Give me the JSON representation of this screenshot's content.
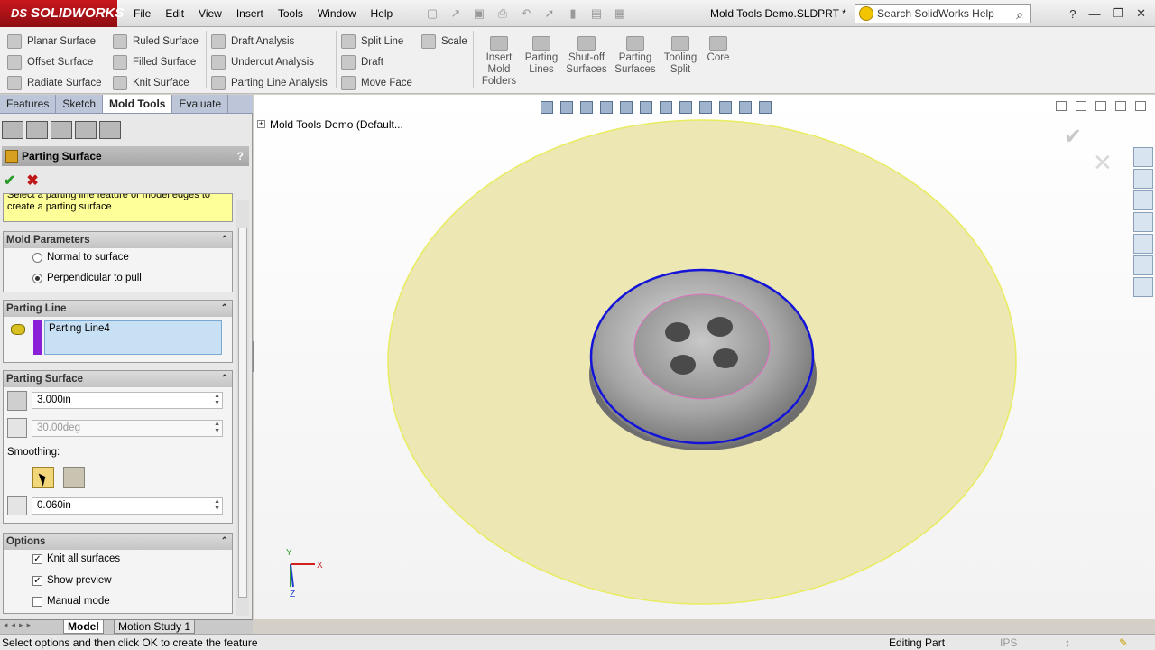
{
  "app": {
    "brand": "SOLIDWORKS",
    "brand_prefix": "DS",
    "document_title": "Mold Tools Demo.SLDPRT *",
    "help_search_placeholder": "Search SolidWorks Help"
  },
  "menu": [
    "File",
    "Edit",
    "View",
    "Insert",
    "Tools",
    "Window",
    "Help"
  ],
  "ribbon": {
    "col1": [
      "Planar Surface",
      "Offset Surface",
      "Radiate Surface"
    ],
    "col2": [
      "Ruled Surface",
      "Filled Surface",
      "Knit Surface"
    ],
    "col3": [
      "Draft Analysis",
      "Undercut Analysis",
      "Parting Line Analysis"
    ],
    "col4": [
      "Split Line",
      "Draft",
      "Move Face"
    ],
    "col5": [
      "Scale"
    ],
    "big": [
      {
        "label_lines": [
          "Insert",
          "Mold",
          "Folders"
        ]
      },
      {
        "label_lines": [
          "Parting",
          "Lines"
        ]
      },
      {
        "label_lines": [
          "Shut-off",
          "Surfaces"
        ]
      },
      {
        "label_lines": [
          "Parting",
          "Surfaces"
        ]
      },
      {
        "label_lines": [
          "Tooling",
          "Split"
        ]
      },
      {
        "label_lines": [
          "Core"
        ]
      }
    ]
  },
  "tabs": [
    "Features",
    "Sketch",
    "Mold Tools",
    "Evaluate"
  ],
  "active_tab": "Mold Tools",
  "property_manager": {
    "title": "Parting Surface",
    "help": "?",
    "message_line1": "Select a parting line feature or model edges to",
    "message_line2": "create a parting surface",
    "groups": {
      "mold_parameters": {
        "title": "Mold Parameters",
        "options": [
          "Normal to surface",
          "Perpendicular to pull"
        ],
        "selected": "Perpendicular to pull"
      },
      "parting_line": {
        "title": "Parting Line",
        "selection": "Parting Line4"
      },
      "parting_surface": {
        "title": "Parting Surface",
        "distance": "3.000in",
        "angle": "30.00deg",
        "smoothing_label": "Smoothing:",
        "smoothing_distance": "0.060in"
      },
      "options": {
        "title": "Options",
        "items": [
          {
            "label": "Knit all surfaces",
            "checked": true
          },
          {
            "label": "Show preview",
            "checked": true
          },
          {
            "label": "Manual mode",
            "checked": false
          }
        ]
      }
    }
  },
  "bottom_tabs": [
    "Model",
    "Motion Study 1"
  ],
  "status": {
    "message": "Select options and then click OK to create the feature",
    "mode": "Editing Part",
    "units": "IPS"
  },
  "viewport": {
    "tree_label": "Mold Tools Demo  (Default...",
    "triad_x": "X",
    "triad_y": "Y",
    "triad_z": "Z"
  },
  "colors": {
    "brand_red": "#c8161d",
    "parting_surface_fill": "#ede7b4",
    "parting_line": "#1414d8",
    "split_line": "#e070c0",
    "selection_box": "#c8e0f4",
    "message_bg": "#ffff99"
  }
}
